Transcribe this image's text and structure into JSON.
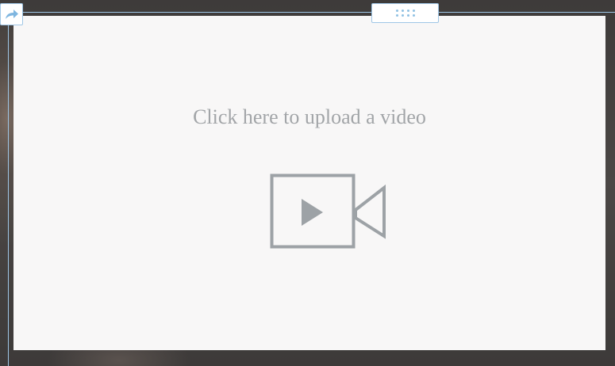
{
  "upload": {
    "prompt": "Click here to upload a video",
    "icon": "video-camera-icon"
  },
  "toolbar": {
    "share_icon": "share-arrow-icon",
    "drag_icon": "drag-handle-icon"
  },
  "colors": {
    "accent": "#9fc6e6",
    "icon_gray": "#9da2a6",
    "panel_bg": "#f8f7f7",
    "text_gray": "#a2a5a8"
  }
}
